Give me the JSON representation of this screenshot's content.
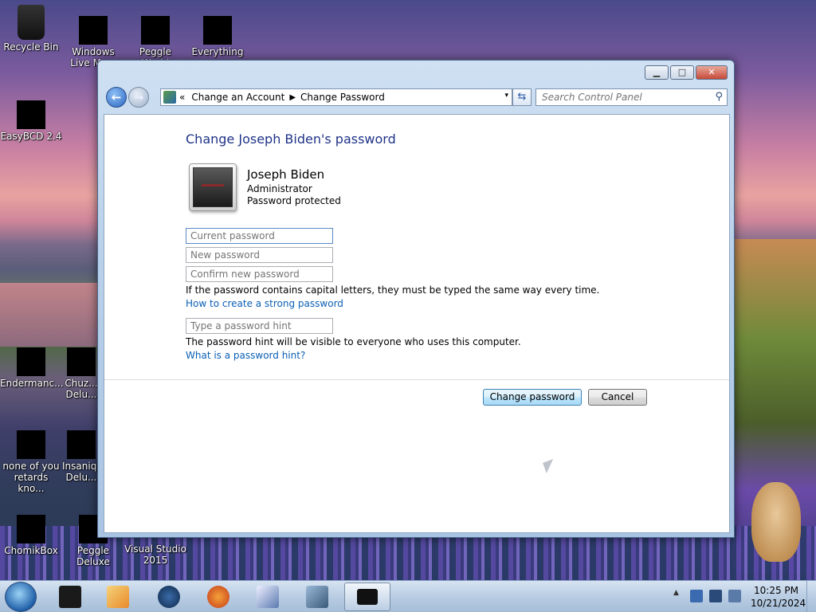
{
  "desktop": {
    "icons": [
      {
        "id": "recycle-bin",
        "label": "Recycle Bin"
      },
      {
        "id": "windows-live-mail",
        "label": "Windows Live Ma..."
      },
      {
        "id": "peggle-world",
        "label": "Peggle World"
      },
      {
        "id": "everything",
        "label": "Everything"
      },
      {
        "id": "easybcd",
        "label": "EasyBCD 2.4"
      },
      {
        "id": "endermanch",
        "label": "Endermanc..."
      },
      {
        "id": "chuzzle-deluxe",
        "label": "Chuz... Delu..."
      },
      {
        "id": "none-of-you",
        "label": "none of you retards kno..."
      },
      {
        "id": "insaniquarium-deluxe",
        "label": "Insaniq... Delu..."
      },
      {
        "id": "chomikbox",
        "label": "ChomikBox"
      },
      {
        "id": "peggle-deluxe",
        "label": "Peggle Deluxe"
      },
      {
        "id": "visual-studio-2015",
        "label": "Visual Studio 2015"
      }
    ]
  },
  "window": {
    "title_buttons": {
      "minimize": "▁",
      "maximize": "□",
      "close": "✕"
    },
    "nav": {
      "back": "←",
      "forward": "→"
    },
    "address": {
      "prefix": "«",
      "crumbs": [
        "Change an Account",
        "Change Password"
      ],
      "separator": "▶",
      "dropdown": "▾"
    },
    "refresh": "⇆",
    "search": {
      "placeholder": "Search Control Panel",
      "icon": "search-icon"
    }
  },
  "content": {
    "heading": "Change Joseph Biden's password",
    "user": {
      "name": "Joseph Biden",
      "role": "Administrator",
      "status": "Password protected"
    },
    "fields": {
      "current": {
        "placeholder": "Current password"
      },
      "new": {
        "placeholder": "New password"
      },
      "confirm": {
        "placeholder": "Confirm new password"
      },
      "hint": {
        "placeholder": "Type a password hint"
      }
    },
    "caps_note": "If the password contains capital letters, they must be typed the same way every time.",
    "strong_link": "How to create a strong password",
    "hint_note": "The password hint will be visible to everyone who uses this computer.",
    "hint_link": "What is a password hint?",
    "buttons": {
      "change": "Change password",
      "cancel": "Cancel"
    }
  },
  "taskbar": {
    "tray_arrow": "▲",
    "clock": {
      "time": "10:25 PM",
      "date": "10/21/2024"
    }
  },
  "colors": {
    "heading": "#1e3287",
    "link": "#0a5fb4",
    "window_frame": "#b9d1ea"
  }
}
